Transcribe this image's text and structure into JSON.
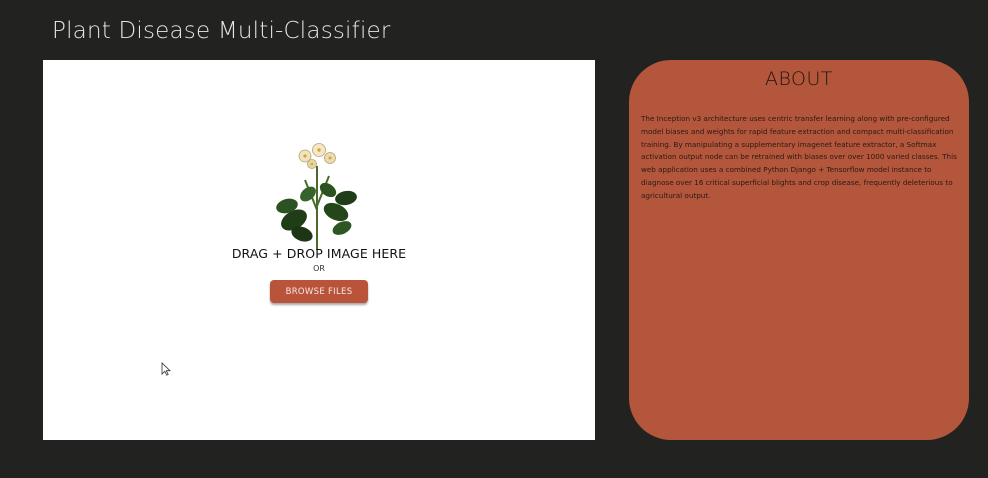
{
  "header": {
    "title": "Plant Disease Multi-Classifier"
  },
  "upload": {
    "drop_label": "DRAG + DROP IMAGE HERE",
    "or_label": "OR",
    "browse_label": "BROWSE FILES"
  },
  "about": {
    "heading": "ABOUT",
    "body": "The Inception v3 architecture uses centric transfer learning along with pre-configured model biases and weights for rapid feature extraction and compact multi-classification training. By manipulating a supplementary imagenet feature extractor, a Softmax activation output node can be retrained with biases over over 1000 varied classes. This web application uses a combined Python Django + Tensorflow model instance to diagnose over 16 critical superficial blights and crop disease, frequently deleterious to agricultural output."
  },
  "colors": {
    "background": "#222220",
    "accent": "#b3563b",
    "button": "#b9543a",
    "panel": "#ffffff"
  },
  "icons": {
    "plant": "plant-illustration",
    "cursor": "mouse-pointer-icon"
  }
}
